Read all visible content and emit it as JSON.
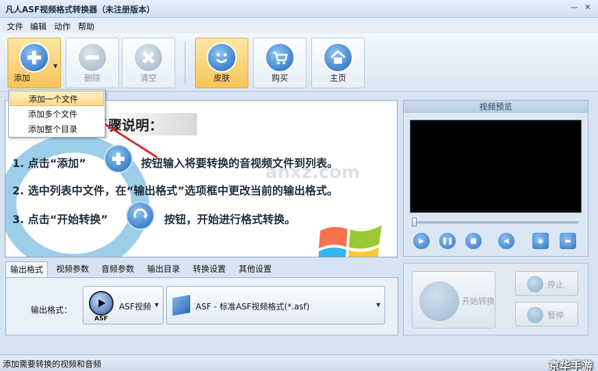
{
  "window": {
    "title": "凡人ASF视频格式转换器（未注册版本）",
    "minimize": "—",
    "close": "✕"
  },
  "menu": [
    "文件",
    "编辑",
    "动作",
    "帮助"
  ],
  "toolbar": {
    "add": "添加",
    "delete": "删除",
    "clear": "清空",
    "skin": "皮肤",
    "buy": "购买",
    "home": "主页"
  },
  "dropdown": [
    "添加一个文件",
    "添加多个文件",
    "添加整个目录"
  ],
  "instructions": {
    "heading": "骤说明：",
    "step1a": "1. 点击“添加”",
    "step1b": "按钮输入将要转换的音视频文件到列表。",
    "step2": "2. 选中列表中文件，在“输出格式”选项框中更改当前的输出格式。",
    "step3a": "3. 点击“开始转换”",
    "step3b": "按钮，开始进行格式转换。",
    "watermark": "anxz.com"
  },
  "preview": {
    "title": "视频预览"
  },
  "tabs": [
    "输出格式",
    "视频参数",
    "音频参数",
    "输出目录",
    "转换设置",
    "其他设置"
  ],
  "output": {
    "label": "输出格式：",
    "format_short": "ASF视频",
    "format_badge": "ASF",
    "format_full": "ASF - 标准ASF视频格式(*.asf)"
  },
  "convert": {
    "start": "开始转换",
    "stop": "停止",
    "pause": "暂停"
  },
  "status": {
    "text": "添加需要转换的视频和音频",
    "brand": "京华手游"
  },
  "colors": {
    "accent": "#f7c558",
    "blue_icon": "#2c72c2",
    "red_arrow": "#d8262a"
  }
}
